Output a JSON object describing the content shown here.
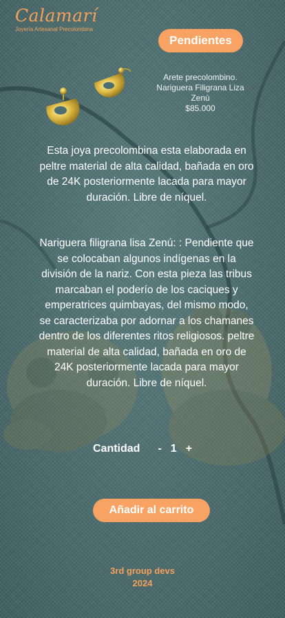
{
  "brand": {
    "name": "Calamarí",
    "tagline": "Joyería Artesanal Precolombina"
  },
  "category": {
    "label": "Pendientes"
  },
  "product": {
    "name": "Arete precolombino. Nariguera Filigrana Liza Zenú",
    "price": "$85.000",
    "description_1": "Esta joya precolombina esta elaborada en peltre material de alta calidad, bañada en oro de 24K posteriormente lacada para mayor duración. Libre de níquel.",
    "description_2": "Nariguera filigrana lisa Zenú: : Pendiente que se colocaban algunos indígenas en la división de la nariz. Con esta pieza las tribus marcaban el poderío de los caciques y emperatrices quimbayas, del mismo modo, se caracterizaba por adornar a los chamanes dentro de los diferentes ritos religiosos. peltre material de alta calidad, bañada en oro de 24K posteriormente lacada para mayor duración. Libre de níquel."
  },
  "quantity": {
    "label": "Cantidad",
    "minus": "-",
    "value": "1",
    "plus": "+"
  },
  "cart": {
    "button_label": "Añadir al carrito"
  },
  "footer": {
    "line1": "3rd group devs",
    "line2": "2024"
  },
  "colors": {
    "accent": "#f8a263",
    "background": "#4d6e70",
    "text": "#ffffff"
  }
}
